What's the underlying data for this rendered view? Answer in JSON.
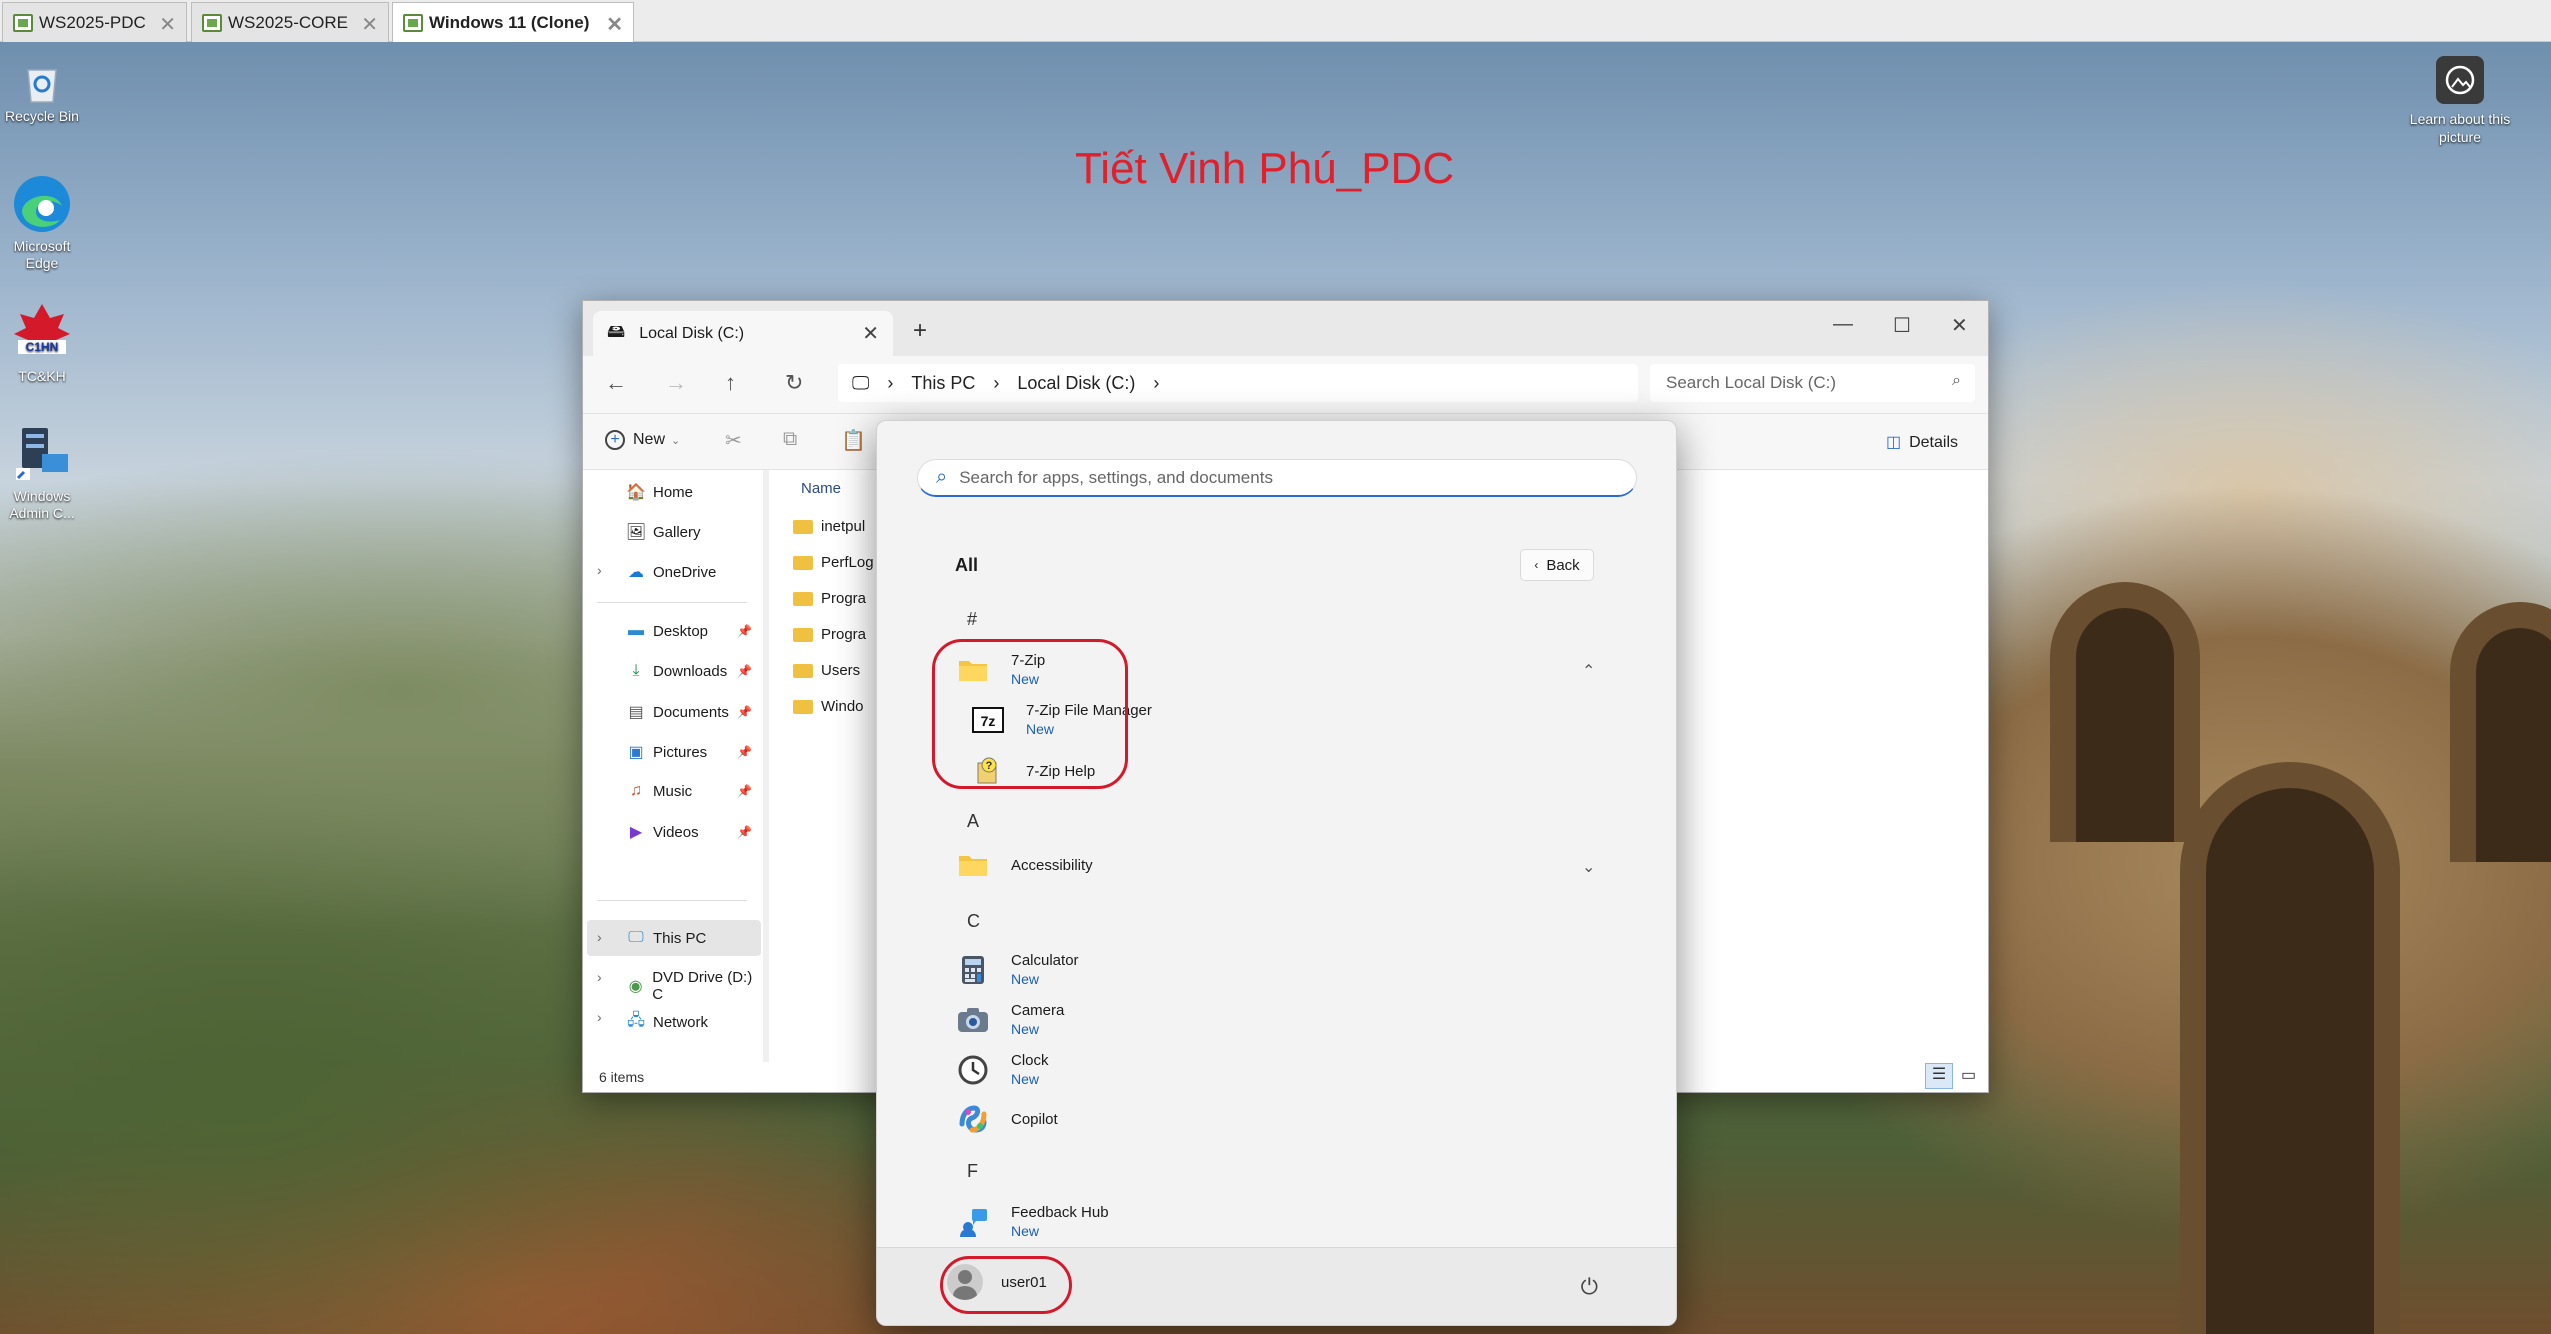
{
  "vm_tabs": [
    {
      "label": "WS2025-PDC"
    },
    {
      "label": "WS2025-CORE"
    },
    {
      "label": "Windows 11 (Clone)"
    }
  ],
  "desktop": {
    "icons": [
      {
        "label": "Recycle Bin",
        "icon": "recycle-bin-icon"
      },
      {
        "label": "Microsoft Edge",
        "icon": "edge-icon"
      },
      {
        "label": "TC&KH",
        "icon": "tc-kh-logo-icon"
      },
      {
        "label": "Windows Admin C...",
        "icon": "windows-admin-center-icon"
      }
    ],
    "watermark": "Tiết Vinh Phú_PDC",
    "learn_about": "Learn about this picture"
  },
  "explorer": {
    "tab_title": "Local Disk (C:)",
    "breadcrumb": [
      "This PC",
      "Local Disk (C:)"
    ],
    "search_placeholder": "Search Local Disk (C:)",
    "new_label": "New",
    "details_label": "Details",
    "sidebar": {
      "top": [
        {
          "label": "Home"
        },
        {
          "label": "Gallery"
        },
        {
          "label": "OneDrive"
        }
      ],
      "pinned": [
        {
          "label": "Desktop"
        },
        {
          "label": "Downloads"
        },
        {
          "label": "Documents"
        },
        {
          "label": "Pictures"
        },
        {
          "label": "Music"
        },
        {
          "label": "Videos"
        }
      ],
      "bottom": [
        {
          "label": "This PC"
        },
        {
          "label": "DVD Drive (D:) C"
        },
        {
          "label": "Network"
        }
      ]
    },
    "column_name": "Name",
    "files": [
      "inetpul",
      "PerfLog",
      "Progra",
      "Progra",
      "Users",
      "Windo"
    ],
    "status": "6 items"
  },
  "start_menu": {
    "search_placeholder": "Search for apps, settings, and documents",
    "heading": "All",
    "back_label": "Back",
    "sections": {
      "hash": "#",
      "a": "A",
      "c": "C",
      "f": "F"
    },
    "apps": {
      "zip": {
        "name": "7-Zip",
        "badge": "New"
      },
      "zip_fm": {
        "name": "7-Zip File Manager",
        "badge": "New"
      },
      "zip_help": {
        "name": "7-Zip Help"
      },
      "accessibility": {
        "name": "Accessibility"
      },
      "calculator": {
        "name": "Calculator",
        "badge": "New"
      },
      "camera": {
        "name": "Camera",
        "badge": "New"
      },
      "clock": {
        "name": "Clock",
        "badge": "New"
      },
      "copilot": {
        "name": "Copilot"
      },
      "feedback": {
        "name": "Feedback Hub",
        "badge": "New"
      }
    },
    "user": "user01"
  },
  "colors": {
    "accent": "#1a5fb4",
    "highlight": "#d41a2a",
    "watermark": "#e0202a"
  }
}
